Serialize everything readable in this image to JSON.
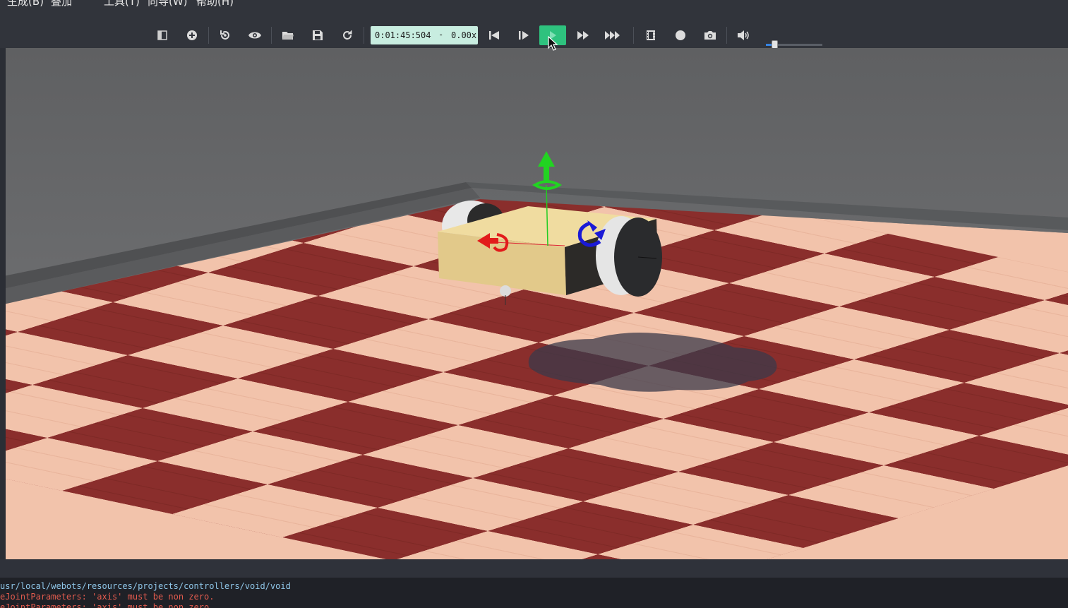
{
  "menu": {
    "items": [
      "生成(B)",
      "叠加",
      "工具(T)",
      "向导(W)",
      "帮助(H)"
    ]
  },
  "toolbar": {
    "buttons": [
      {
        "name": "toggle-scene-tree-icon"
      },
      {
        "name": "add-node-icon"
      },
      {
        "name": "reset-viewpoint-icon"
      },
      {
        "name": "view-eye-icon"
      },
      {
        "name": "open-world-icon"
      },
      {
        "name": "save-world-icon"
      },
      {
        "name": "reload-world-icon"
      },
      {
        "name": "reset-simulation-icon"
      },
      {
        "name": "step-icon"
      },
      {
        "name": "run-realtime-icon"
      },
      {
        "name": "run-fast-icon"
      },
      {
        "name": "run-fastest-icon"
      },
      {
        "name": "record-movie-icon"
      },
      {
        "name": "record-animation-icon"
      },
      {
        "name": "screenshot-icon"
      },
      {
        "name": "volume-icon"
      }
    ],
    "time": "0:01:45:504",
    "time_separator": "-",
    "speed": "0.00x",
    "volume_level": 0.15,
    "accent_color": "#2ec27e"
  },
  "console": {
    "lines": [
      {
        "text": "usr/local/webots/resources/projects/controllers/void/void",
        "kind": "info"
      },
      {
        "text": "eJointParameters: 'axis' must be non zero.",
        "kind": "error"
      },
      {
        "text": "eJointParameters: 'axis' must be non zero.",
        "kind": "error"
      }
    ]
  }
}
